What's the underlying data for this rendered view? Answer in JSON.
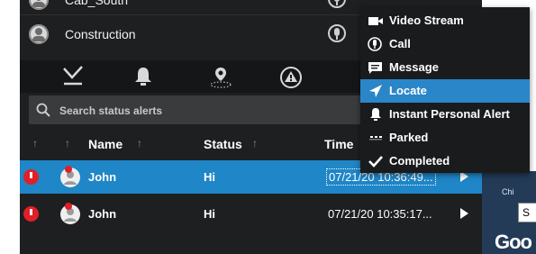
{
  "groups": [
    {
      "name": "Cab_South"
    },
    {
      "name": "Construction"
    }
  ],
  "tabs": [
    "alerts-icon",
    "bell-icon",
    "location-pin-icon",
    "warning-icon"
  ],
  "search": {
    "placeholder": "Search status alerts"
  },
  "columns": {
    "name": "Name",
    "status": "Status",
    "time": "Time"
  },
  "alerts": [
    {
      "name": "John",
      "status": "Hi",
      "time": "07/21/20 10:36:49...",
      "selected": true
    },
    {
      "name": "John",
      "status": "Hi",
      "time": "07/21/20 10:35:17...",
      "selected": false
    }
  ],
  "map": {
    "label": "Chi",
    "box": "S",
    "logo": "Goo"
  },
  "menu": {
    "items": [
      {
        "label": "Video Stream",
        "icon": "video-camera-icon"
      },
      {
        "label": "Call",
        "icon": "microphone-icon"
      },
      {
        "label": "Message",
        "icon": "message-icon"
      },
      {
        "label": "Locate",
        "icon": "locate-arrow-icon",
        "active": true
      },
      {
        "label": "Instant Personal Alert",
        "icon": "bell-icon"
      },
      {
        "label": "Parked",
        "icon": "parked-icon"
      },
      {
        "label": "Completed",
        "icon": "checkmark-icon"
      }
    ]
  },
  "colors": {
    "selection": "#1f86c7",
    "menu_active": "#2a86c8",
    "alert": "#e01f26",
    "panel": "#1e1f21"
  }
}
